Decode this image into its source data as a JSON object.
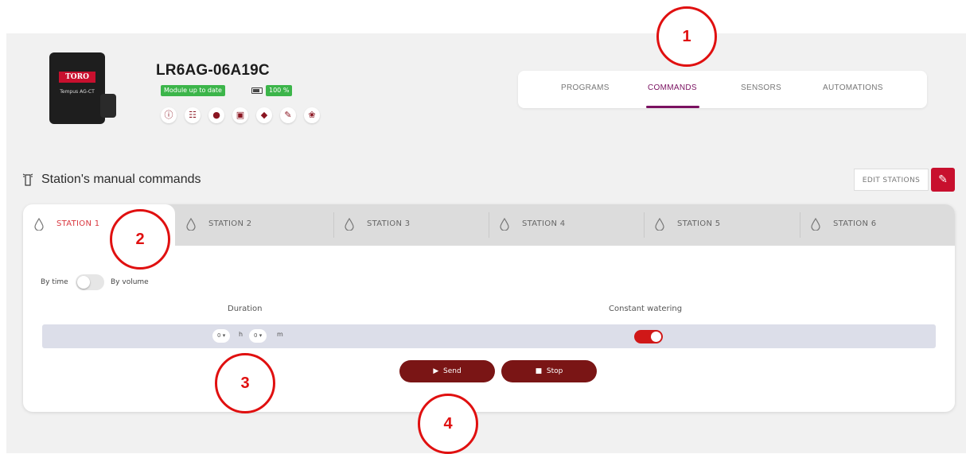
{
  "device": {
    "name": "LR6AG-06A19C",
    "logo_text": "TORO",
    "model_text": "Tempus AG-CT",
    "module_status": "Module up to date",
    "battery": "100 %"
  },
  "action_icons": [
    "info-icon",
    "network-icon",
    "globe-icon",
    "save-icon",
    "tag-icon",
    "pencil-icon",
    "plant-icon"
  ],
  "nav": {
    "items": [
      {
        "label": "PROGRAMS"
      },
      {
        "label": "COMMANDS"
      },
      {
        "label": "SENSORS"
      },
      {
        "label": "AUTOMATIONS"
      }
    ],
    "active": "COMMANDS",
    "active_color": "#7a1060"
  },
  "section": {
    "title": "Station's manual commands",
    "edit_label": "EDIT STATIONS"
  },
  "stations": {
    "tabs": [
      {
        "label": "STATION 1"
      },
      {
        "label": "STATION 2"
      },
      {
        "label": "STATION 3"
      },
      {
        "label": "STATION 4"
      },
      {
        "label": "STATION 5"
      },
      {
        "label": "STATION 6"
      }
    ],
    "active": "STATION 1"
  },
  "mode": {
    "left": "By time",
    "right": "By volume"
  },
  "columns": {
    "duration": "Duration",
    "constant": "Constant watering"
  },
  "duration": {
    "hours": "0",
    "hours_unit": "h",
    "minutes": "0",
    "minutes_unit": "m"
  },
  "buttons": {
    "send": "Send",
    "stop": "Stop"
  },
  "annotations": [
    "1",
    "2",
    "3",
    "4"
  ],
  "colors": {
    "accent_red": "#c8102e",
    "primary_button": "#7a1515",
    "status_green": "#3cb54a",
    "annotation_red": "#e01010"
  }
}
